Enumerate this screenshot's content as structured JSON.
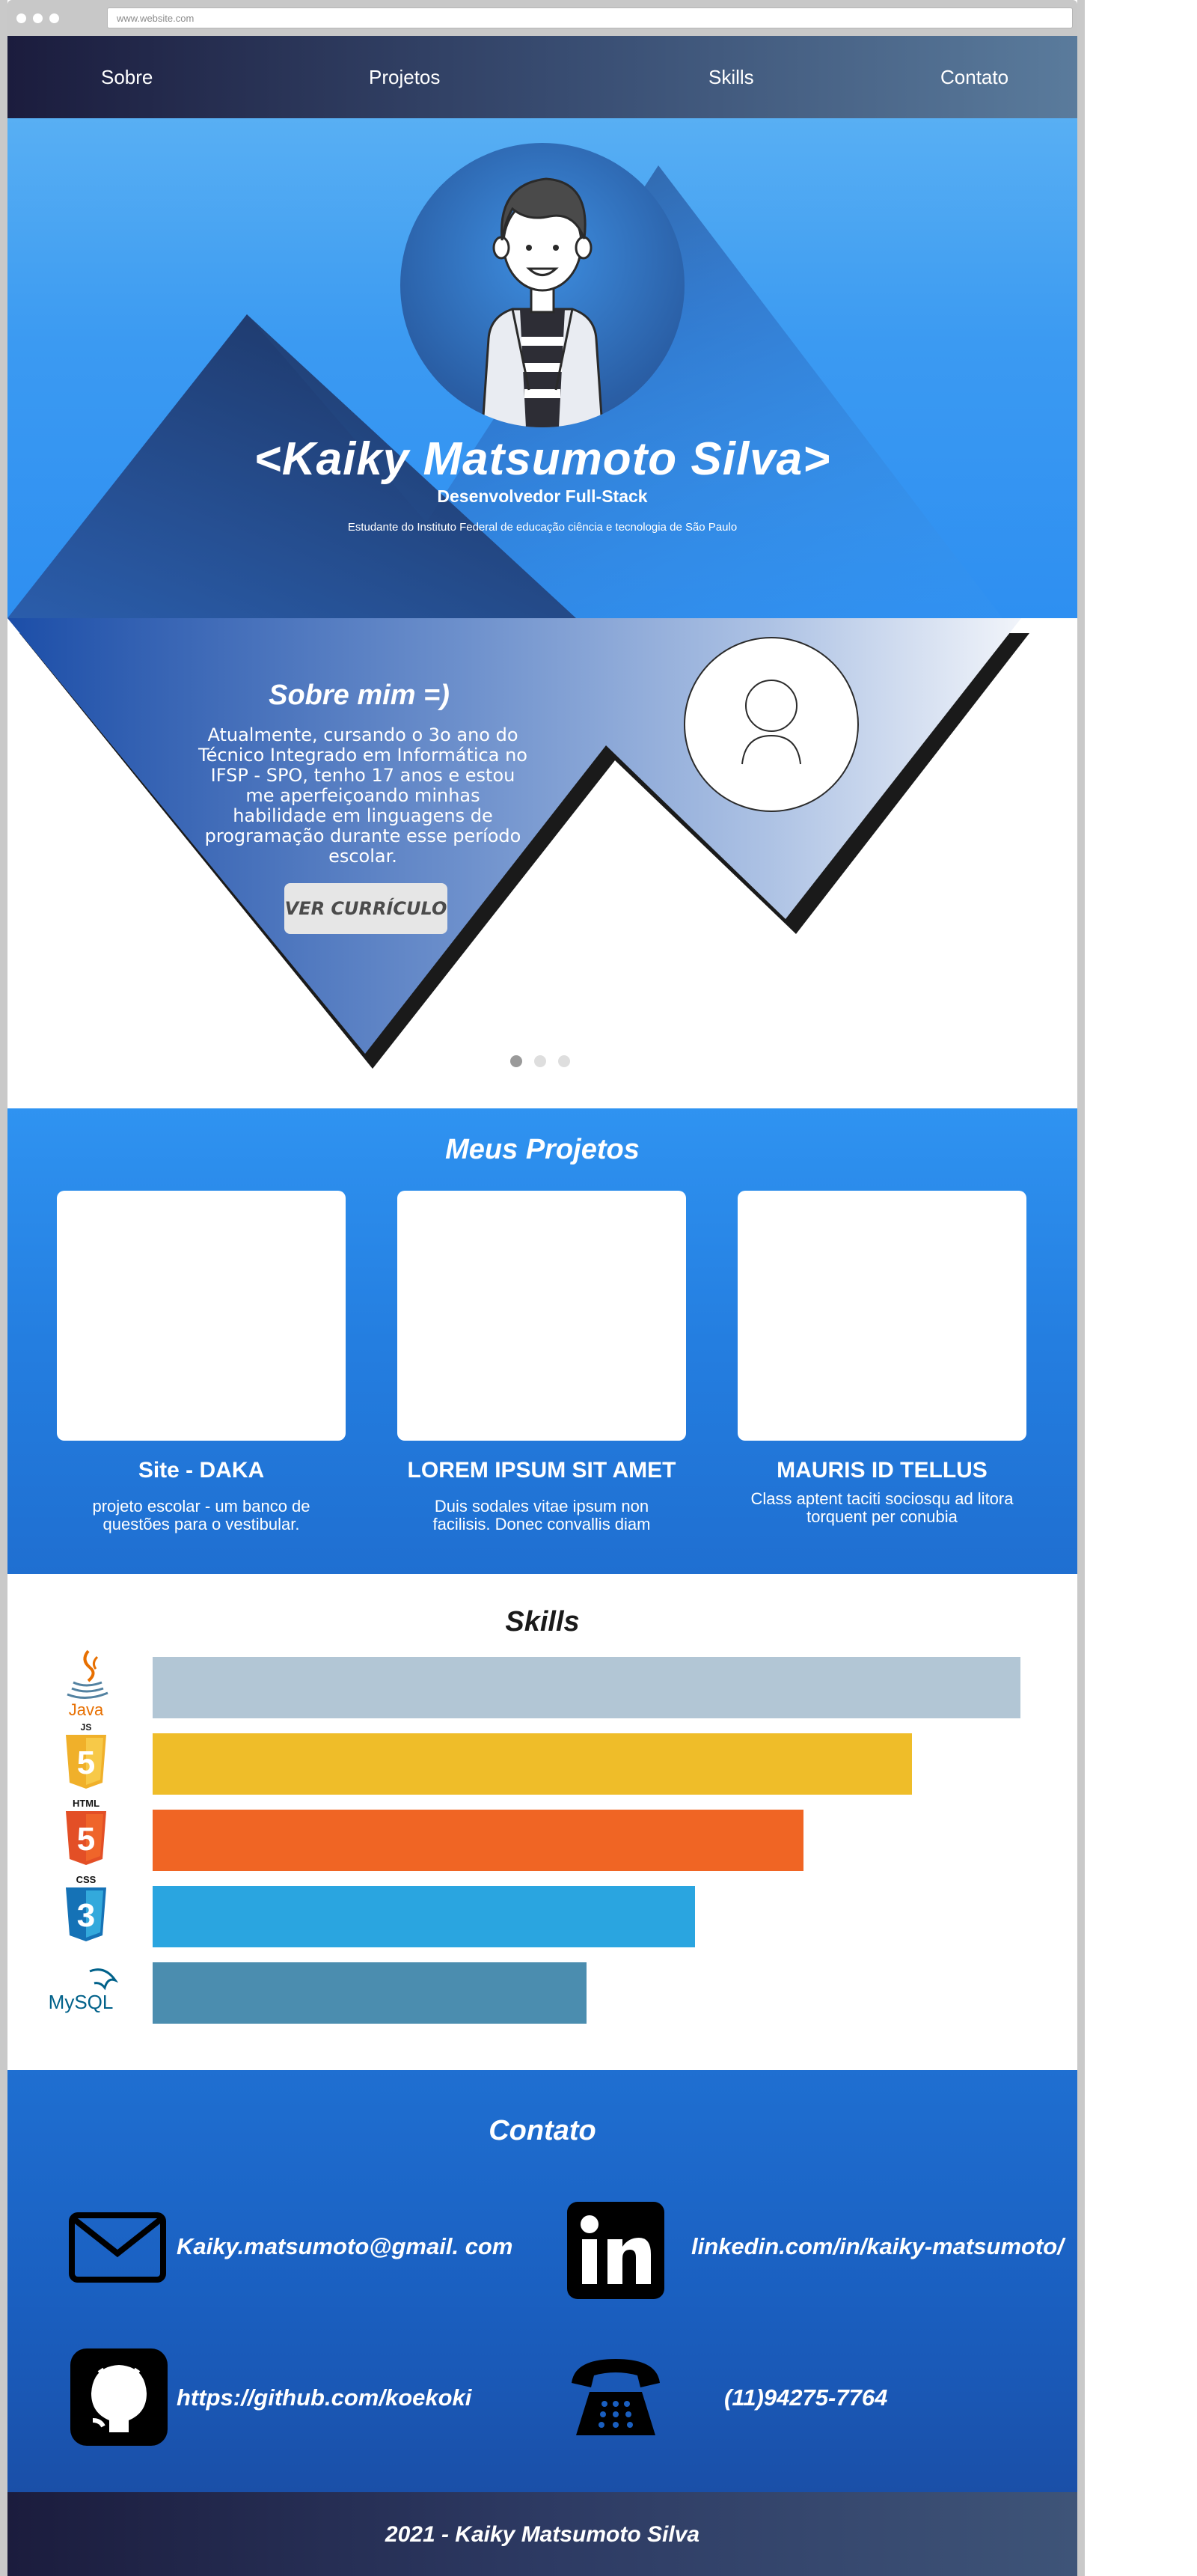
{
  "browser": {
    "url": "www.website.com"
  },
  "nav": {
    "items": [
      "Sobre",
      "Projetos",
      "Skills",
      "Contato"
    ]
  },
  "hero": {
    "name": "<Kaiky Matsumoto Silva>",
    "role": "Desenvolvedor Full-Stack",
    "school": "Estudante do Instituto Federal de educação ciência e tecnologia de São Paulo"
  },
  "sobre": {
    "title": "Sobre mim =)",
    "text": "Atualmente, cursando o 3o ano do Técnico Integrado em Informática no IFSP - SPO, tenho 17 anos e estou me aperfeiçoando minhas habilidade em linguagens de programação durante esse período escolar.",
    "button": "VER CURRÍCULO",
    "carousel": {
      "count": 3,
      "active": 1
    }
  },
  "projetos": {
    "title": "Meus Projetos",
    "items": [
      {
        "title": "Site - DAKA",
        "desc": "projeto escolar - um banco de questões para o vestibular."
      },
      {
        "title": "LOREM IPSUM SIT AMET",
        "desc": "Duis sodales vitae ipsum non facilisis. Donec convallis diam"
      },
      {
        "title": "MAURIS ID TELLUS",
        "desc": "Class aptent taciti sociosqu ad litora torquent per conubia"
      }
    ]
  },
  "skills": {
    "title": "Skills",
    "items": [
      {
        "name": "Java",
        "icon": "java-icon",
        "level": 1.0,
        "color": "#b2c6d5"
      },
      {
        "name": "JS",
        "icon": "js-icon",
        "level": 0.875,
        "color": "#efbd29"
      },
      {
        "name": "HTML",
        "icon": "html-icon",
        "level": 0.75,
        "color": "#f06524"
      },
      {
        "name": "CSS",
        "icon": "css-icon",
        "level": 0.625,
        "color": "#2aa5e0"
      },
      {
        "name": "MySQL",
        "icon": "mysql-icon",
        "level": 0.5,
        "color": "#4b8daf"
      }
    ],
    "icon_labels": {
      "java": "Java",
      "js": "JS",
      "html": "HTML",
      "css": "CSS",
      "mysql": "MySQL"
    }
  },
  "contato": {
    "title": "Contato",
    "email": "Kaiky.matsumoto@gmail. com",
    "linkedin": "linkedin.com/in/kaiky-matsumoto/",
    "github": "https://github.com/koekoki",
    "phone": "(11)94275-7764"
  },
  "footer": {
    "text": "2021 - Kaiky Matsumoto Silva"
  },
  "colors": {
    "nav_dark": "#1b1c3d",
    "hero_blue": "#3b9af2",
    "accent_blue": "#247ee0",
    "button_gray": "#e6e6e6"
  }
}
